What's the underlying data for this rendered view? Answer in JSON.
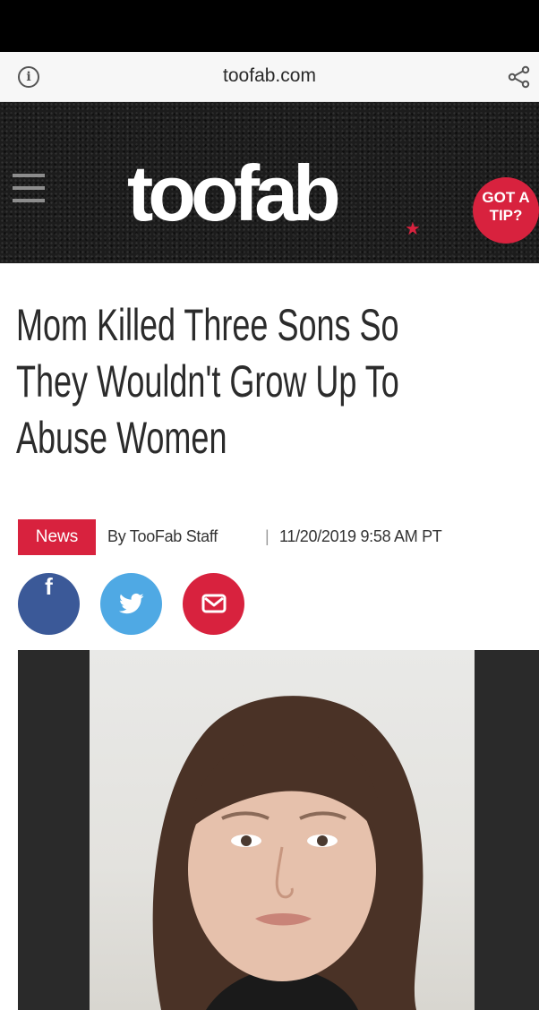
{
  "browser": {
    "url": "toofab.com"
  },
  "site": {
    "logo_text": "toofab",
    "tip_button_line1": "GOT A",
    "tip_button_line2": "TIP?"
  },
  "article": {
    "headline_lines": [
      "Mom Killed Three Sons So",
      "They Wouldn't Grow Up To",
      "Abuse Women"
    ],
    "category": "News",
    "byline": "By TooFab Staff",
    "separator": "|",
    "date": "11/20/2019 9:58 AM PT"
  },
  "share": {
    "facebook_glyph": "f",
    "icons": [
      "facebook-icon",
      "twitter-icon",
      "email-icon"
    ]
  },
  "colors": {
    "brand_red": "#d8223e",
    "facebook_blue": "#3b5998",
    "twitter_blue": "#4fa9e4",
    "header_bg": "#1c1c1c"
  }
}
